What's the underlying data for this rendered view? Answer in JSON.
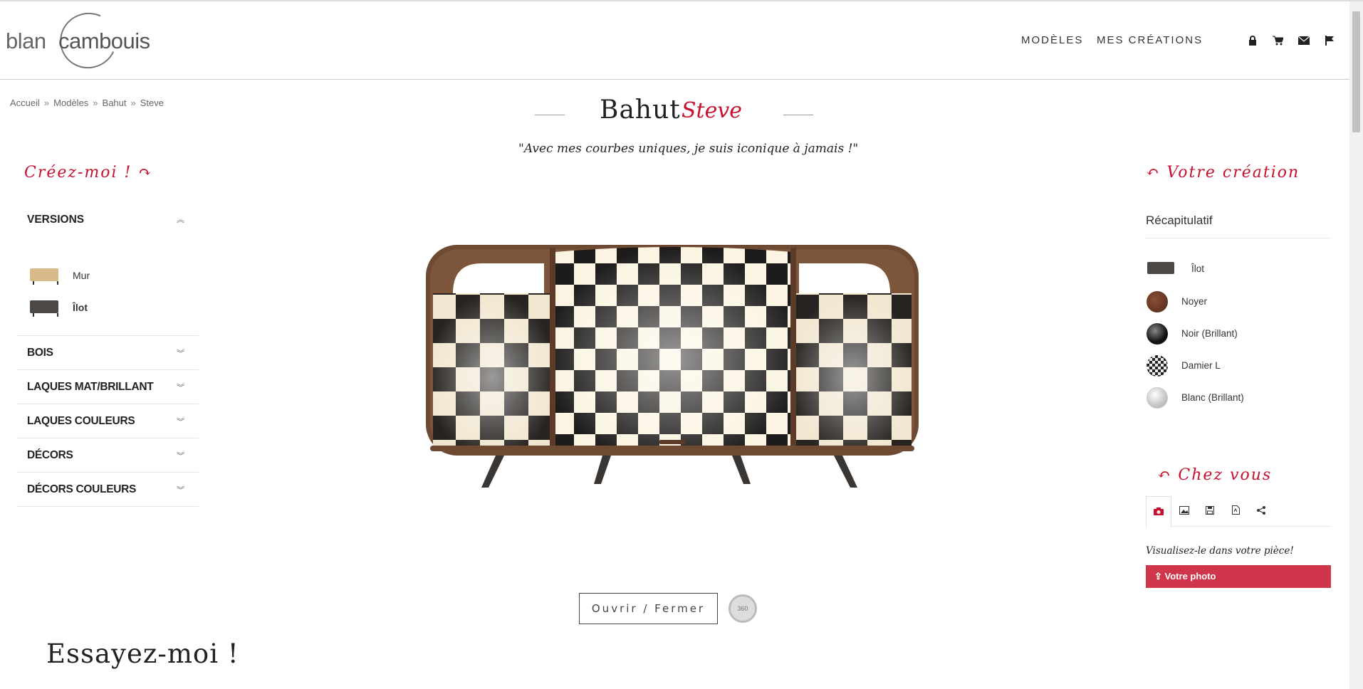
{
  "header": {
    "logo_part1": "blan",
    "logo_part2": "cambouis",
    "nav": [
      "MODÈLES",
      "MES CRÉATIONS"
    ],
    "icons": [
      "lock-icon",
      "cart-icon",
      "envelope-icon",
      "flag-icon"
    ]
  },
  "breadcrumb": [
    "Accueil",
    "Modèles",
    "Bahut",
    "Steve"
  ],
  "breadcrumb_sep": "»",
  "title": {
    "main": "Bahut",
    "accent": "Steve"
  },
  "quote": "\"Avec mes courbes uniques, je suis iconique à jamais !\"",
  "left": {
    "hand_label": "Créez-moi ! ↷",
    "versions_label": "VERSIONS",
    "versions": [
      {
        "label": "Mur",
        "color": "#d9b98a"
      },
      {
        "label": "Îlot",
        "color": "#4d4844"
      }
    ],
    "sections": [
      "BOIS",
      "LAQUES MAT/BRILLANT",
      "LAQUES COULEURS",
      "DÉCORS",
      "DÉCORS COULEURS"
    ]
  },
  "buttons": {
    "open_close": "Ouvrir / Fermer",
    "view360": "360"
  },
  "try_me": "Essayez-moi !",
  "right": {
    "hand_label": "↶ Votre création",
    "recap_title": "Récapitulatif",
    "items": [
      {
        "label": "Îlot",
        "kind": "version"
      },
      {
        "label": "Noyer",
        "color": "#6b3a28"
      },
      {
        "label": "Noir (Brillant)",
        "color": "#222222"
      },
      {
        "label": "Damier L",
        "color": "checker"
      },
      {
        "label": "Blanc (Brillant)",
        "color": "#eeeeee"
      }
    ],
    "chez_label": "↶ Chez vous",
    "tabs": [
      "camera-icon",
      "image-icon",
      "save-icon",
      "pdf-icon",
      "share-icon"
    ],
    "visual_text": "Visualisez-le dans votre pièce!",
    "photo_button": "Votre photo"
  },
  "colors": {
    "accent": "#c8102e",
    "button": "#d0364b"
  }
}
